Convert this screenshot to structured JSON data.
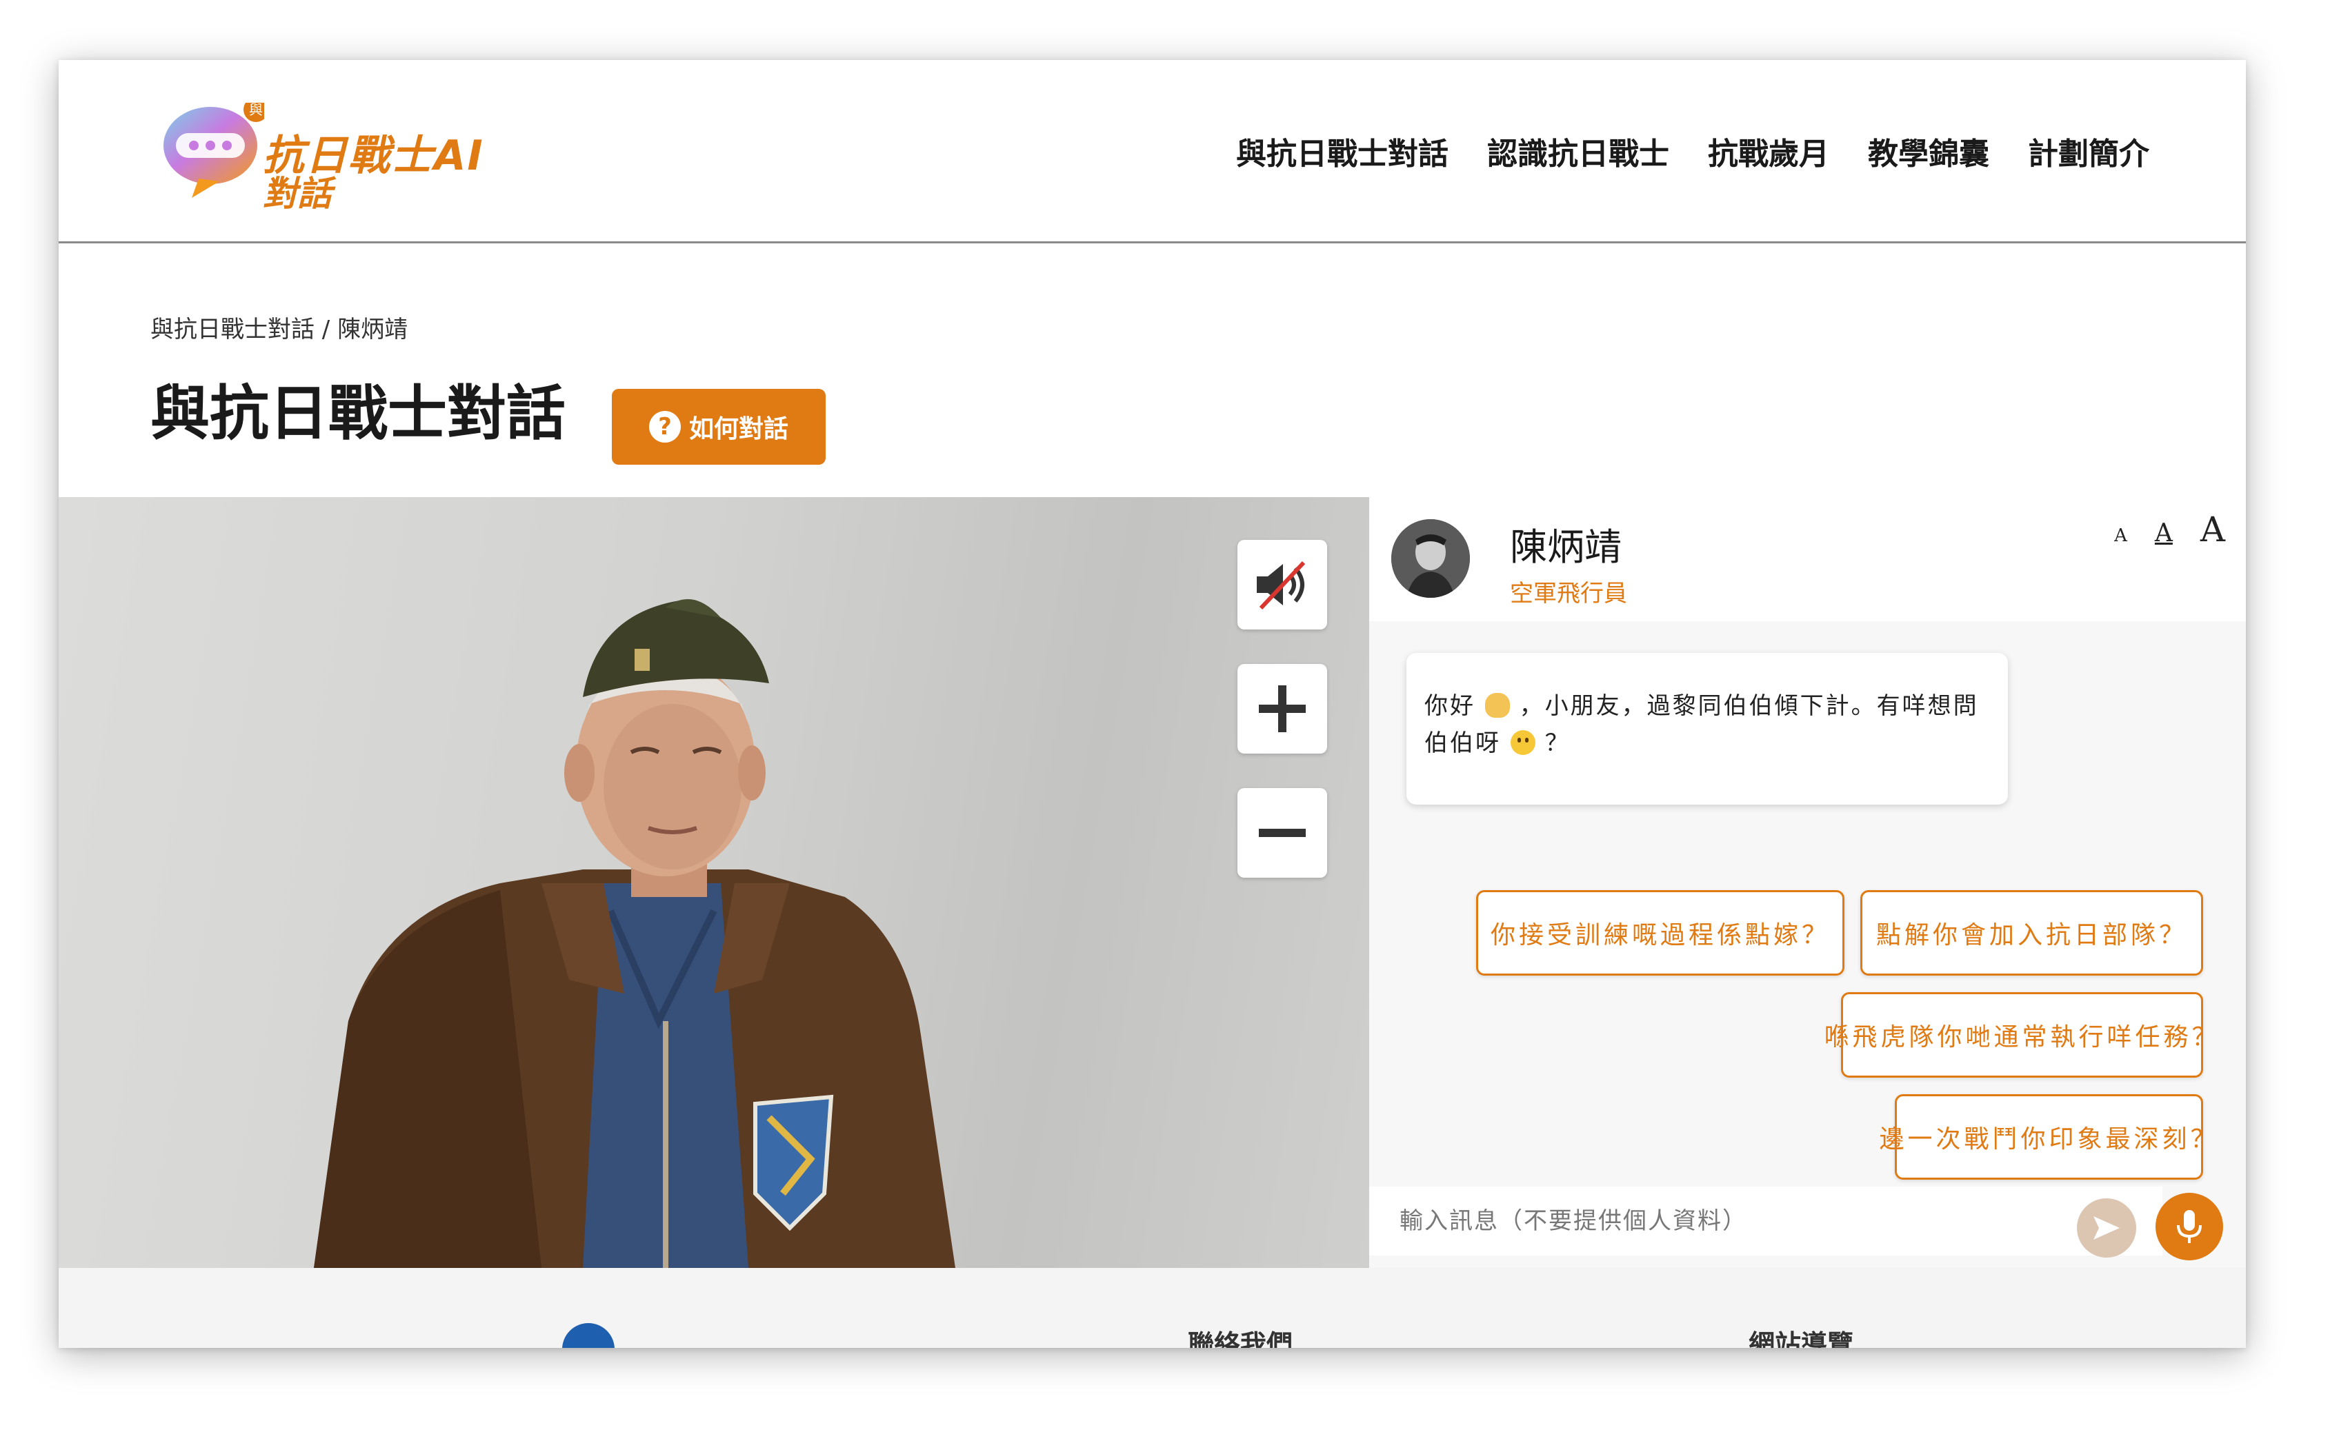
{
  "header": {
    "logo_badge": "與",
    "logo_line1": "抗日戰士AI",
    "logo_line2": "對話",
    "nav": [
      {
        "label": "與抗日戰士對話"
      },
      {
        "label": "認識抗日戰士"
      },
      {
        "label": "抗戰歲月"
      },
      {
        "label": "教學錦囊"
      },
      {
        "label": "計劃簡介"
      }
    ]
  },
  "breadcrumb": "與抗日戰士對話 / 陳炳靖",
  "page_title": "與抗日戰士對話",
  "howto": {
    "icon": "?",
    "label": "如何對話"
  },
  "avatar_controls": {
    "mute_icon": "speaker-muted-icon",
    "zoom_in_icon": "plus-icon",
    "zoom_out_icon": "minus-icon"
  },
  "chat": {
    "profile_name": "陳炳靖",
    "profile_role": "空軍飛行員",
    "font_sizes": {
      "small": "A",
      "medium": "A",
      "large": "A"
    },
    "bot_message": {
      "part1": "你好",
      "part2": "，小朋友，過黎同伯伯傾下計。有咩想問伯伯呀",
      "part3": "？"
    },
    "suggestions": [
      "你接受訓練嘅過程係點嫁？",
      "點解你會加入抗日部隊？",
      "喺飛虎隊你哋通常執行咩任務？",
      "邊一次戰鬥你印象最深刻？"
    ],
    "input_placeholder": "輸入訊息（不要提供個人資料）"
  },
  "footer": {
    "contact": "聯絡我們",
    "nav": "網站導覽"
  },
  "colors": {
    "accent": "#e07a13",
    "send_button": "#dcc6b2"
  }
}
